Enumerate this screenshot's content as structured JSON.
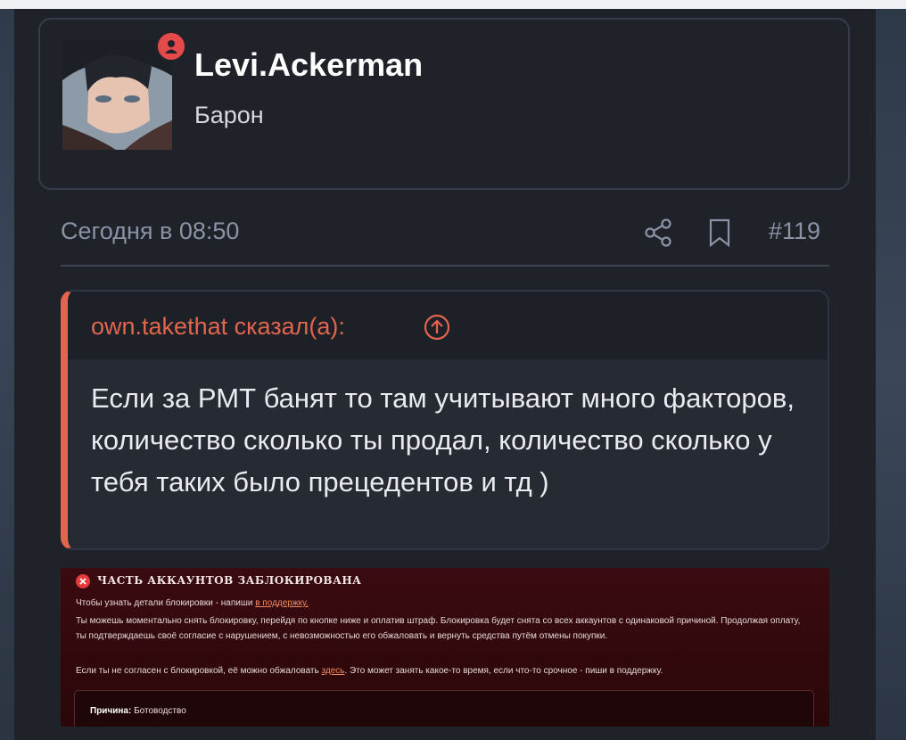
{
  "user": {
    "name": "Levi.Ackerman",
    "title": "Барон"
  },
  "post": {
    "date": "Сегодня в 08:50",
    "number": "#119"
  },
  "quote": {
    "author": "own.takethat сказал(а):",
    "text": "Если за РМТ банят то там учитывают много факторов, количество сколько ты продал, количество сколько у тебя таких было прецедентов и тд )"
  },
  "ban_notice": {
    "title": "ЧАСТЬ АККАУНТОВ ЗАБЛОКИРОВАНА",
    "support_line": "Чтобы узнать детали блокировки - напиши",
    "support_link": "в поддержку.",
    "fine_text": "Ты можешь моментально снять блокировку, перейдя по кнопке ниже и оплатив штраф. Блокировка будет снята со всех аккаунтов с одинаковой причиной. Продолжая оплату, ты подтверждаешь своё согласие с нарушением, с невозможностью его обжаловать и вернуть средства путём отмены покупки.",
    "appeal_before": "Если ты не согласен с блокировкой, её можно обжаловать",
    "appeal_link": "здесь",
    "appeal_after": ". Это может занять какое-то время, если что-то срочное - пиши в поддержку.",
    "reason_label": "Причина:",
    "reason_value": "Ботоводство"
  },
  "colors": {
    "accent": "#e2654e",
    "badge": "#e44a4a",
    "panel": "#1f2228"
  },
  "icons": [
    "online-status-icon",
    "share-icon",
    "bookmark-icon",
    "arrow-up-circle-icon",
    "error-x-icon"
  ]
}
